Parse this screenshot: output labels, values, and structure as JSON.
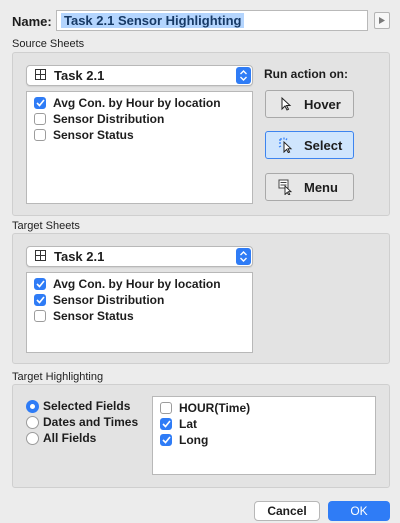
{
  "name_row": {
    "label": "Name:",
    "value": "Task 2.1 Sensor Highlighting"
  },
  "source_sheets": {
    "title": "Source Sheets",
    "dropdown_value": "Task 2.1",
    "items": [
      {
        "label": "Avg Con. by Hour by location",
        "checked": true
      },
      {
        "label": "Sensor Distribution",
        "checked": false
      },
      {
        "label": "Sensor Status",
        "checked": false
      }
    ],
    "run_action_label": "Run action on:",
    "actions": [
      {
        "label": "Hover",
        "icon": "pointer-icon",
        "selected": false
      },
      {
        "label": "Select",
        "icon": "select-cursor-icon",
        "selected": true
      },
      {
        "label": "Menu",
        "icon": "menu-cursor-icon",
        "selected": false
      }
    ]
  },
  "target_sheets": {
    "title": "Target Sheets",
    "dropdown_value": "Task 2.1",
    "items": [
      {
        "label": "Avg Con. by Hour by location",
        "checked": true
      },
      {
        "label": "Sensor Distribution",
        "checked": true
      },
      {
        "label": "Sensor Status",
        "checked": false
      }
    ]
  },
  "target_highlighting": {
    "title": "Target Highlighting",
    "options": [
      {
        "label": "Selected Fields",
        "selected": true
      },
      {
        "label": "Dates and Times",
        "selected": false
      },
      {
        "label": "All Fields",
        "selected": false
      }
    ],
    "fields": [
      {
        "label": "HOUR(Time)",
        "checked": false
      },
      {
        "label": "Lat",
        "checked": true
      },
      {
        "label": "Long",
        "checked": true
      }
    ]
  },
  "footer": {
    "cancel_label": "Cancel",
    "ok_label": "OK"
  },
  "colors": {
    "accent": "#2f7cf6",
    "selection_highlight": "#b4d5fe",
    "panel_bg": "#e3e3e3",
    "window_bg": "#ececec"
  }
}
